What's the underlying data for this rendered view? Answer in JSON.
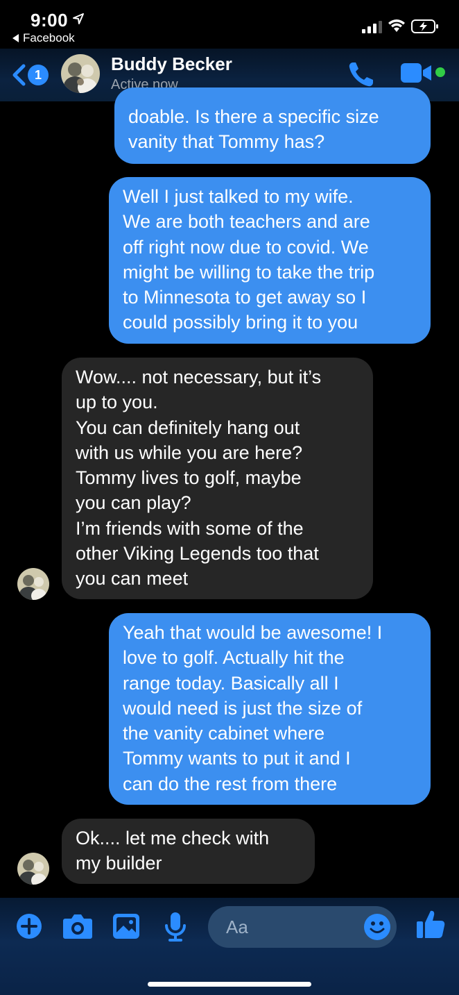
{
  "status_bar": {
    "time": "9:00",
    "back_app": "Facebook"
  },
  "header": {
    "unread_count": "1",
    "contact_name": "Buddy Becker",
    "presence": "Active now"
  },
  "messages": [
    {
      "direction": "outgoing",
      "text": "doable. Is there a specific size\nvanity that Tommy has?"
    },
    {
      "direction": "outgoing",
      "text": "Well I just talked to my wife.\nWe are both teachers and are\noff right now due to covid. We\nmight be willing to take the trip\nto Minnesota to get away so I\ncould possibly bring it to you"
    },
    {
      "direction": "incoming",
      "text": "Wow.... not necessary, but it’s\nup to you.\nYou can definitely hang out\nwith us while you are here?\nTommy lives to golf, maybe\nyou can play?\nI’m friends with some of the\nother Viking Legends too that\nyou can meet"
    },
    {
      "direction": "outgoing",
      "text": "Yeah that would be awesome! I\nlove to golf. Actually hit the\nrange today. Basically all I\nwould need is just the size of\nthe vanity cabinet where\nTommy wants to put it and I\ncan do the rest from there"
    },
    {
      "direction": "incoming",
      "text": "Ok.... let me check with\nmy builder"
    }
  ],
  "composer": {
    "placeholder": "Aa"
  },
  "colors": {
    "outgoing_bubble": "#3c8ff0",
    "incoming_bubble": "#262626",
    "accent": "#2b8cff",
    "online": "#31cc46"
  }
}
